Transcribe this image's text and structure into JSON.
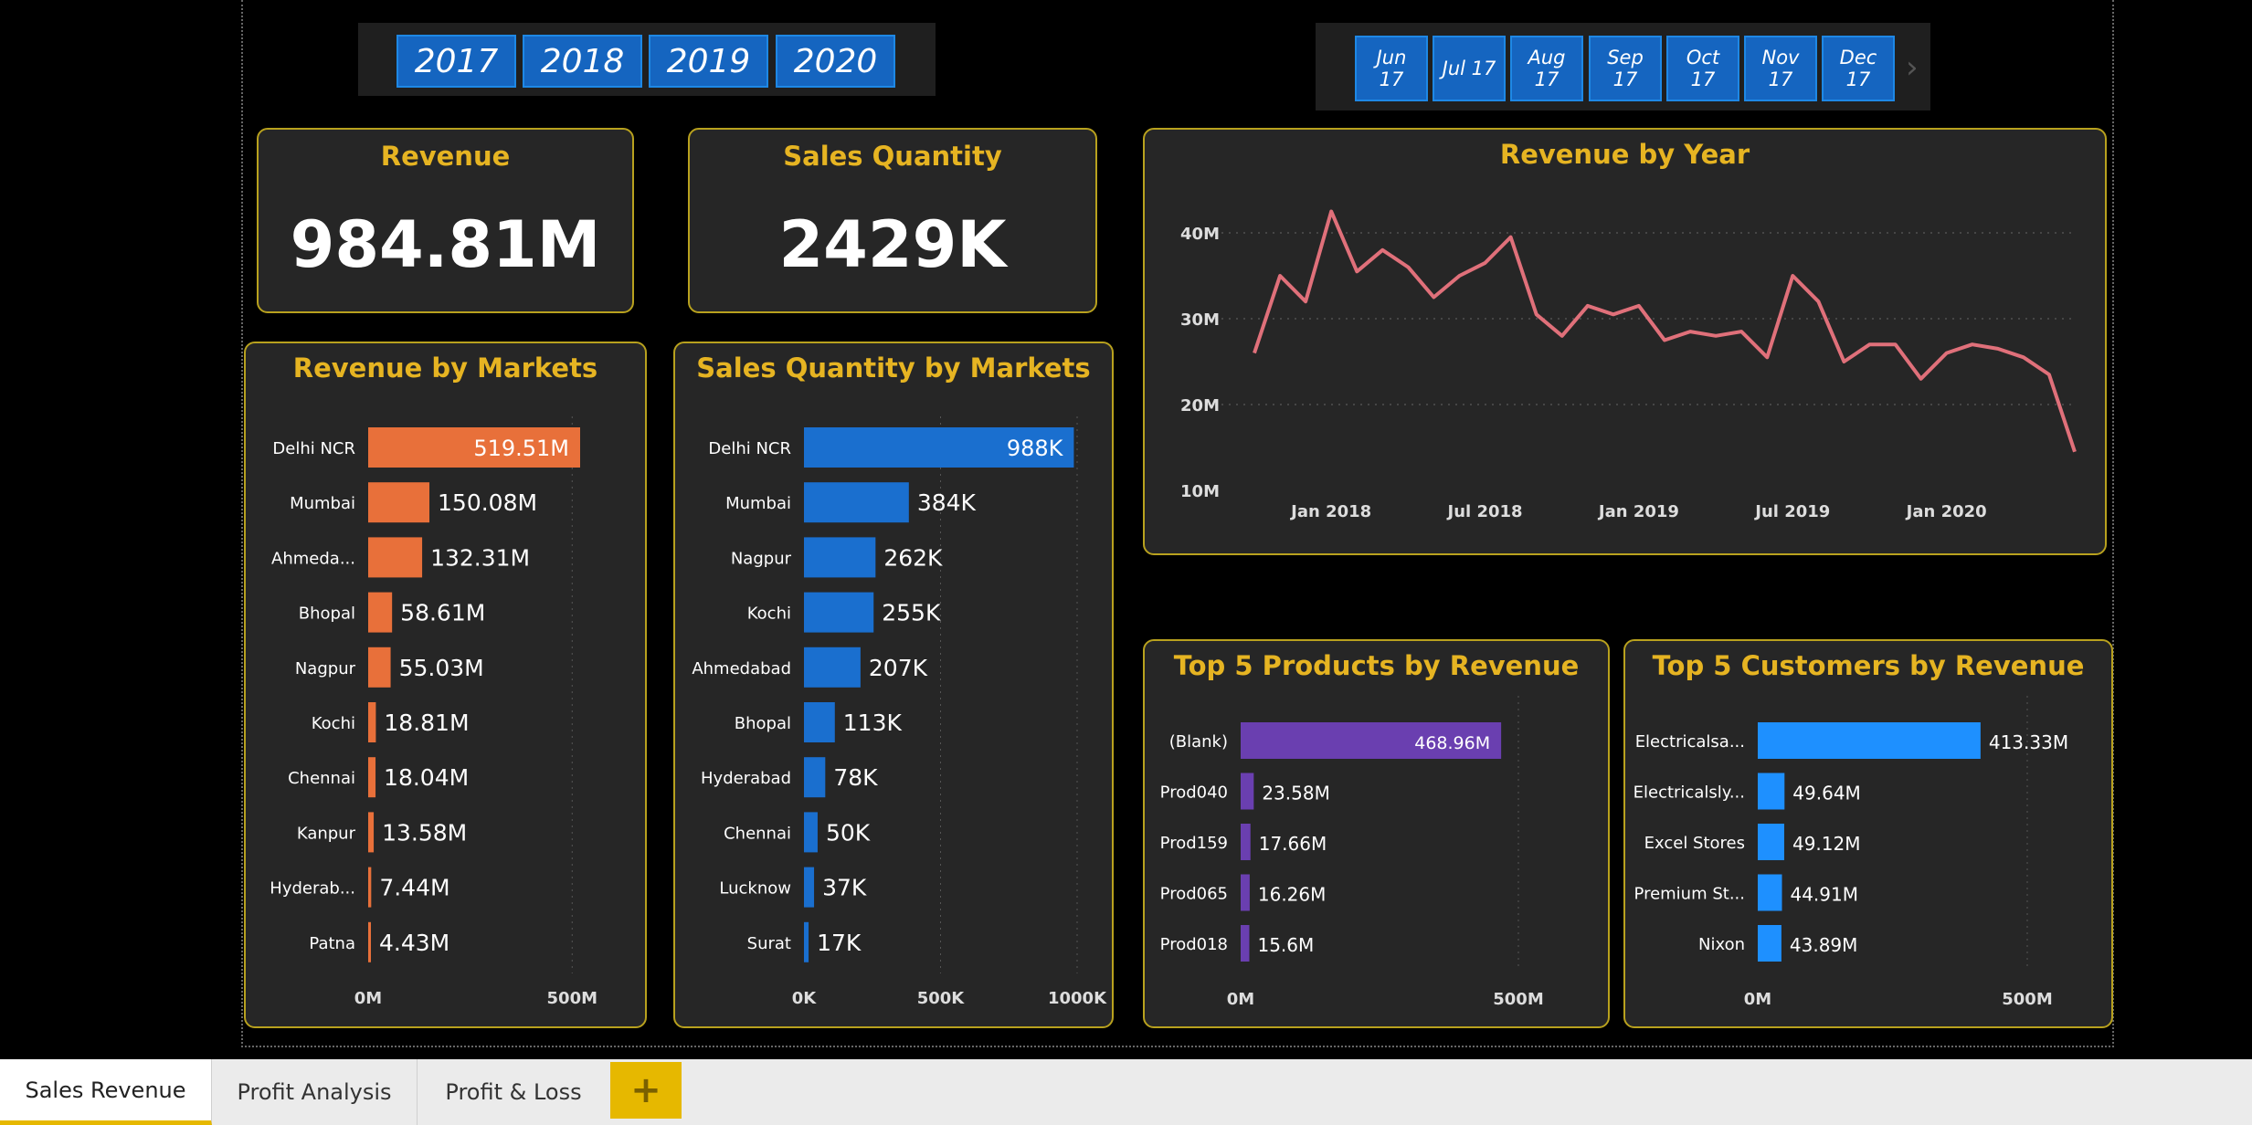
{
  "year_slicer": [
    "2017",
    "2018",
    "2019",
    "2020"
  ],
  "month_slicer": [
    {
      "m": "Jun",
      "y": "17"
    },
    {
      "m": "Jul 17",
      "y": ""
    },
    {
      "m": "Aug",
      "y": "17"
    },
    {
      "m": "Sep",
      "y": "17"
    },
    {
      "m": "Oct",
      "y": "17"
    },
    {
      "m": "Nov",
      "y": "17"
    },
    {
      "m": "Dec",
      "y": "17"
    }
  ],
  "month_next_icon": "chevron-right-icon",
  "kpi": {
    "revenue_title": "Revenue",
    "revenue_value": "984.81M",
    "qty_title": "Sales Quantity",
    "qty_value": "2429K"
  },
  "colors": {
    "title": "#e6b422",
    "revenue_bar": "#e8703a",
    "qty_bar": "#1a6fcf",
    "product_bar": "#6a3fb0",
    "customer_bar": "#1e90ff",
    "line": "#e0707a",
    "border": "#b8a11e"
  },
  "tabs": [
    "Sales Revenue",
    "Profit Analysis",
    "Profit & Loss"
  ],
  "tab_add_label": "+",
  "chart_data": [
    {
      "id": "rev_markets",
      "type": "bar",
      "orientation": "horizontal",
      "title": "Revenue by Markets",
      "categories": [
        "Delhi NCR",
        "Mumbai",
        "Ahmeda...",
        "Bhopal",
        "Nagpur",
        "Kochi",
        "Chennai",
        "Kanpur",
        "Hyderab...",
        "Patna"
      ],
      "values": [
        519.51,
        150.08,
        132.31,
        58.61,
        55.03,
        18.81,
        18.04,
        13.58,
        7.44,
        4.43
      ],
      "labels": [
        "519.51M",
        "150.08M",
        "132.31M",
        "58.61M",
        "55.03M",
        "18.81M",
        "18.04M",
        "13.58M",
        "7.44M",
        "4.43M"
      ],
      "xlim": [
        0,
        519.51
      ],
      "xticks": [
        "0M",
        "500M"
      ],
      "xtick_values": [
        0,
        500
      ]
    },
    {
      "id": "qty_markets",
      "type": "bar",
      "orientation": "horizontal",
      "title": "Sales Quantity by Markets",
      "categories": [
        "Delhi NCR",
        "Mumbai",
        "Nagpur",
        "Kochi",
        "Ahmedabad",
        "Bhopal",
        "Hyderabad",
        "Chennai",
        "Lucknow",
        "Surat"
      ],
      "values": [
        988,
        384,
        262,
        255,
        207,
        113,
        78,
        50,
        37,
        17
      ],
      "labels": [
        "988K",
        "384K",
        "262K",
        "255K",
        "207K",
        "113K",
        "78K",
        "50K",
        "37K",
        "17K"
      ],
      "xlim": [
        0,
        1000
      ],
      "xticks": [
        "0K",
        "500K",
        "1000K"
      ],
      "xtick_values": [
        0,
        500,
        1000
      ]
    },
    {
      "id": "rev_year",
      "type": "line",
      "title": "Revenue by Year",
      "x": [
        "2017-10",
        "2017-11",
        "2017-12",
        "2018-01",
        "2018-02",
        "2018-03",
        "2018-04",
        "2018-05",
        "2018-06",
        "2018-07",
        "2018-08",
        "2018-09",
        "2018-10",
        "2018-11",
        "2018-12",
        "2019-01",
        "2019-02",
        "2019-03",
        "2019-04",
        "2019-05",
        "2019-06",
        "2019-07",
        "2019-08",
        "2019-09",
        "2019-10",
        "2019-11",
        "2019-12",
        "2020-01",
        "2020-02",
        "2020-03",
        "2020-04",
        "2020-05",
        "2020-06"
      ],
      "values": [
        26,
        35,
        32,
        42.5,
        35.5,
        38,
        36,
        32.5,
        35,
        36.5,
        39.5,
        30.5,
        28,
        31.5,
        30.5,
        31.5,
        27.5,
        28.5,
        28,
        28.5,
        25.5,
        35,
        32,
        25,
        27,
        27,
        23,
        26,
        27,
        26.5,
        25.5,
        23.5,
        14.5
      ],
      "ylim": [
        10,
        42.5
      ],
      "yticks": [
        "10M",
        "20M",
        "30M",
        "40M"
      ],
      "ytick_values": [
        10,
        20,
        30,
        40
      ],
      "xticks": [
        "Jan 2018",
        "Jul 2018",
        "Jan 2019",
        "Jul 2019",
        "Jan 2020"
      ],
      "xtick_values": [
        "2018-01",
        "2018-07",
        "2019-01",
        "2019-07",
        "2020-01"
      ]
    },
    {
      "id": "top_products",
      "type": "bar",
      "orientation": "horizontal",
      "title": "Top 5 Products by Revenue",
      "categories": [
        "(Blank)",
        "Prod040",
        "Prod159",
        "Prod065",
        "Prod018"
      ],
      "values": [
        468.96,
        23.58,
        17.66,
        16.26,
        15.6
      ],
      "labels": [
        "468.96M",
        "23.58M",
        "17.66M",
        "16.26M",
        "15.6M"
      ],
      "xlim": [
        0,
        500
      ],
      "xticks": [
        "0M",
        "500M"
      ],
      "xtick_values": [
        0,
        500
      ]
    },
    {
      "id": "top_customers",
      "type": "bar",
      "orientation": "horizontal",
      "title": "Top 5 Customers by Revenue",
      "categories": [
        "Electricalsa...",
        "Electricalsly...",
        "Excel Stores",
        "Premium St...",
        "Nixon"
      ],
      "values": [
        413.33,
        49.64,
        49.12,
        44.91,
        43.89
      ],
      "labels": [
        "413.33M",
        "49.64M",
        "49.12M",
        "44.91M",
        "43.89M"
      ],
      "xlim": [
        0,
        500
      ],
      "xticks": [
        "0M",
        "500M"
      ],
      "xtick_values": [
        0,
        500
      ]
    }
  ]
}
